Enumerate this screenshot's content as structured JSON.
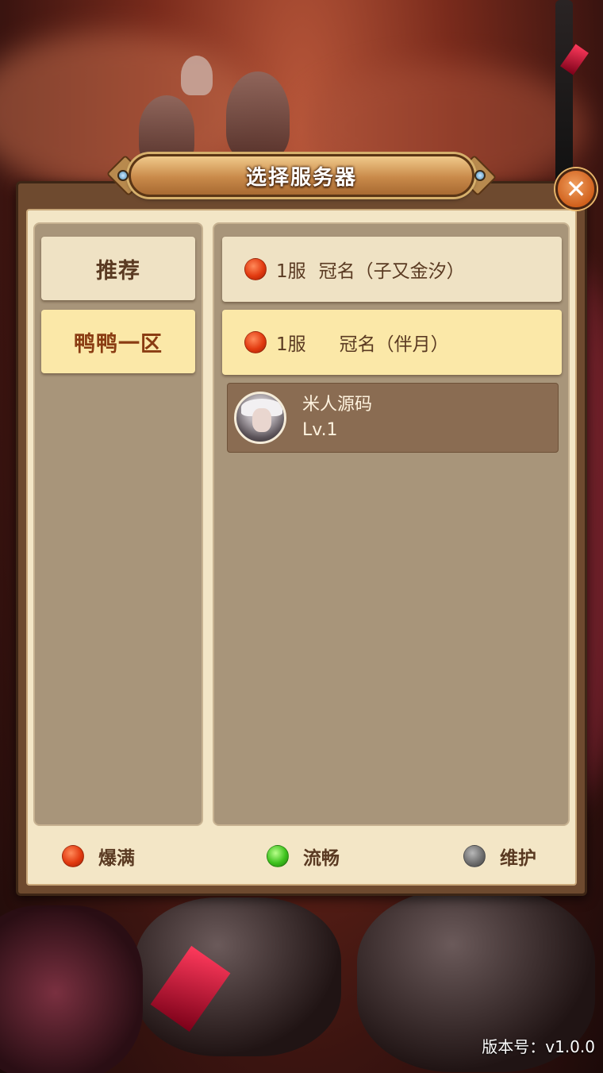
{
  "dialog": {
    "title": "选择服务器",
    "close_label": "✕"
  },
  "left_tabs": [
    {
      "label": "推荐",
      "state": "inactive"
    },
    {
      "label": "鸭鸭一区",
      "state": "active"
    }
  ],
  "servers": [
    {
      "number": "1服",
      "name": "冠名（子又金汐）",
      "status": "full",
      "selected": false
    },
    {
      "number": "1服",
      "name": "冠名（伴月）",
      "status": "full",
      "selected": true
    }
  ],
  "character": {
    "name": "米人源码",
    "level": "Lv.1",
    "avatar": "white-haired-hero-portrait"
  },
  "legend": [
    {
      "label": "爆满",
      "status": "full",
      "color": "#e23a10"
    },
    {
      "label": "流畅",
      "status": "smooth",
      "color": "#3ec21e"
    },
    {
      "label": "维护",
      "status": "maintenance",
      "color": "#707070"
    }
  ],
  "footer": {
    "version": "版本号：v1.0.0"
  },
  "colors": {
    "panel_frame": "#6e4a2f",
    "panel_bg": "#f3e6c6",
    "column_bg": "#a8957a",
    "active_row": "#fbe8a8",
    "text_brown": "#5a3a22"
  }
}
